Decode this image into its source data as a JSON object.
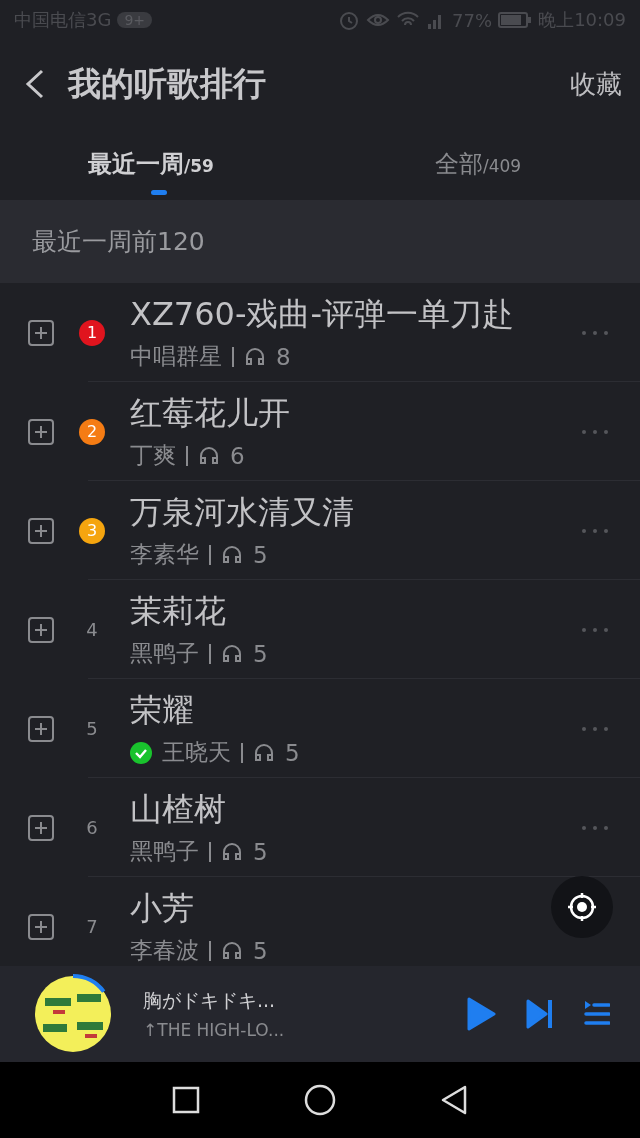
{
  "status_bar": {
    "carrier": "中国电信3G",
    "badge": "9+",
    "battery": "77%",
    "time": "晚上10:09"
  },
  "header": {
    "title": "我的听歌排行",
    "action": "收藏"
  },
  "tabs": [
    {
      "label": "最近一周",
      "count": "/59",
      "selected": true
    },
    {
      "label": "全部",
      "count": "/409",
      "selected": false
    }
  ],
  "section": {
    "title": "最近一周前120"
  },
  "songs": [
    {
      "rank": "1",
      "kind": "badge",
      "color": "#e0141e",
      "title": "XZ760-戏曲-评弹一单刀赴",
      "artist": "中唱群星",
      "verified": false,
      "plays": "8"
    },
    {
      "rank": "2",
      "kind": "badge",
      "color": "#f57c14",
      "title": "红莓花儿开",
      "artist": "丁爽",
      "verified": false,
      "plays": "6"
    },
    {
      "rank": "3",
      "kind": "badge",
      "color": "#f5a50f",
      "title": "万泉河水清又清",
      "artist": "李素华",
      "verified": false,
      "plays": "5"
    },
    {
      "rank": "4",
      "kind": "plain",
      "title": "茉莉花",
      "artist": "黑鸭子",
      "verified": false,
      "plays": "5"
    },
    {
      "rank": "5",
      "kind": "plain",
      "title": "荣耀",
      "artist": "王晓天",
      "verified": true,
      "plays": "5"
    },
    {
      "rank": "6",
      "kind": "plain",
      "title": "山楂树",
      "artist": "黑鸭子",
      "verified": false,
      "plays": "5"
    },
    {
      "rank": "7",
      "kind": "plain",
      "title": "小芳",
      "artist": "李春波",
      "verified": false,
      "plays": "5"
    }
  ],
  "player": {
    "title": "胸がドキドキ...",
    "subtitle": "↑THE HIGH-LO...",
    "level": 0.15
  }
}
